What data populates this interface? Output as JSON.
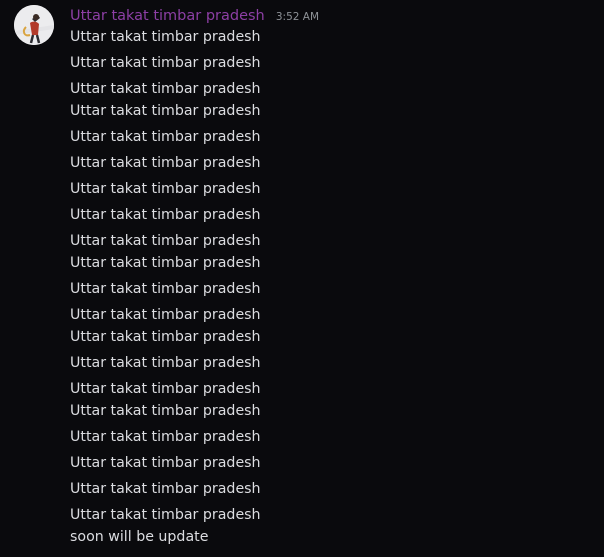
{
  "author": {
    "name": "Uttar takat timbar pradesh",
    "timestamp": "3:52 AM",
    "name_color": "#8d3fa5"
  },
  "messages": [
    "Uttar takat timbar pradesh",
    "Uttar takat timbar pradesh",
    "Uttar takat timbar pradesh",
    "Uttar takat timbar pradesh",
    "Uttar takat timbar pradesh",
    "Uttar takat timbar pradesh",
    "Uttar takat timbar pradesh",
    "Uttar takat timbar pradesh",
    "Uttar takat timbar pradesh",
    "Uttar takat timbar pradesh",
    "Uttar takat timbar pradesh",
    "Uttar takat timbar pradesh",
    "Uttar takat timbar pradesh",
    "Uttar takat timbar pradesh",
    "Uttar takat timbar pradesh",
    "Uttar takat timbar pradesh",
    "Uttar takat timbar pradesh",
    "Uttar takat timbar pradesh",
    "Uttar takat timbar pradesh",
    "Uttar takat timbar pradesh",
    "soon will be update"
  ],
  "colors": {
    "background": "#0a0a0d",
    "message_text": "#dcdde1",
    "timestamp": "#8e9297"
  }
}
